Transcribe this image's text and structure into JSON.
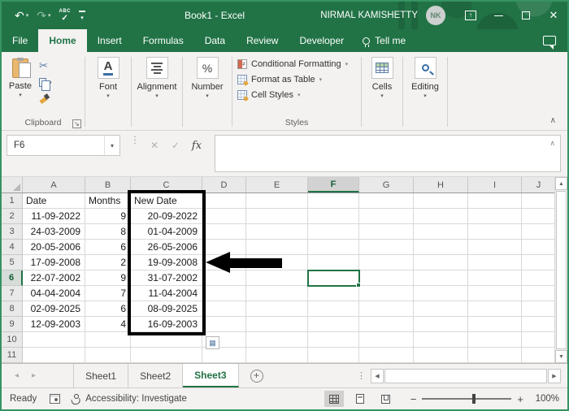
{
  "titlebar": {
    "title": "Book1 - Excel",
    "user": "NIRMAL KAMISHETTY",
    "avatar_initials": "NK"
  },
  "tabs": {
    "items": [
      "File",
      "Home",
      "Insert",
      "Formulas",
      "Data",
      "Review",
      "Developer"
    ],
    "active": "Home",
    "tell_me": "Tell me"
  },
  "ribbon": {
    "paste_label": "Paste",
    "clipboard_label": "Clipboard",
    "font_label": "Font",
    "alignment_label": "Alignment",
    "number_label": "Number",
    "styles": {
      "label": "Styles",
      "items": [
        "Conditional Formatting",
        "Format as Table",
        "Cell Styles"
      ]
    },
    "cells_label": "Cells",
    "editing_label": "Editing"
  },
  "formula_bar": {
    "name_box": "F6",
    "formula": ""
  },
  "sheet": {
    "columns": [
      "A",
      "B",
      "C",
      "D",
      "E",
      "F",
      "G",
      "H",
      "I",
      "J"
    ],
    "selected_column": "F",
    "selected_row": 6,
    "selected_cell": "F6",
    "rows": [
      {
        "n": 1,
        "A": "Date",
        "B": "Months",
        "C": "New Date"
      },
      {
        "n": 2,
        "A": "11-09-2022",
        "B": "9",
        "C": "20-09-2022"
      },
      {
        "n": 3,
        "A": "24-03-2009",
        "B": "8",
        "C": "01-04-2009"
      },
      {
        "n": 4,
        "A": "20-05-2006",
        "B": "6",
        "C": "26-05-2006"
      },
      {
        "n": 5,
        "A": "17-09-2008",
        "B": "2",
        "C": "19-09-2008"
      },
      {
        "n": 6,
        "A": "22-07-2002",
        "B": "9",
        "C": "31-07-2002"
      },
      {
        "n": 7,
        "A": "04-04-2004",
        "B": "7",
        "C": "11-04-2004"
      },
      {
        "n": 8,
        "A": "02-09-2025",
        "B": "6",
        "C": "08-09-2025"
      },
      {
        "n": 9,
        "A": "12-09-2003",
        "B": "4",
        "C": "16-09-2003"
      },
      {
        "n": 10,
        "A": "",
        "B": "",
        "C": ""
      },
      {
        "n": 11,
        "A": "",
        "B": "",
        "C": ""
      }
    ]
  },
  "sheet_tabs": {
    "items": [
      "Sheet1",
      "Sheet2",
      "Sheet3"
    ],
    "active": "Sheet3"
  },
  "status_bar": {
    "ready": "Ready",
    "accessibility": "Accessibility: Investigate",
    "zoom": "100%"
  },
  "colors": {
    "accent_green": "#217346",
    "annotation_black": "#000000"
  }
}
